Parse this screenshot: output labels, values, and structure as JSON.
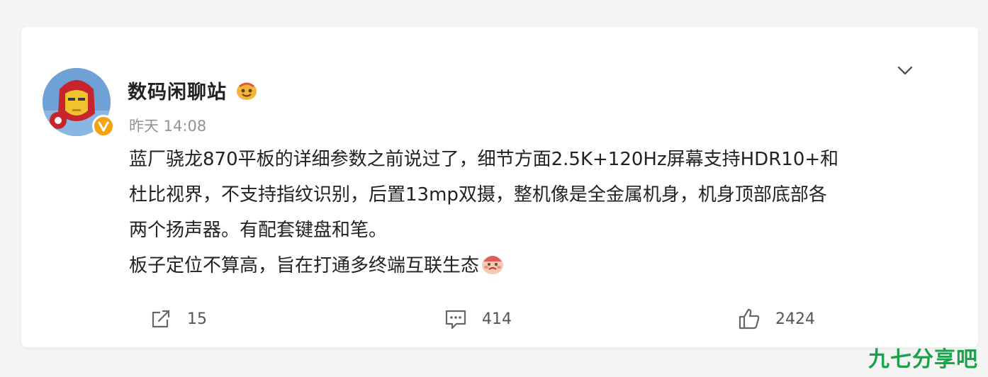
{
  "post": {
    "username": "数码闲聊站",
    "timestamp": "昨天 14:08",
    "content_lines": [
      "蓝厂骁龙870平板的详细参数之前说过了，细节方面2.5K+120Hz屏幕支持HDR10+和",
      "杜比视界，不支持指纹识别，后置13mp双摄，整机像是全金属机身，机身顶部底部各",
      "两个扬声器。有配套键盘和笔。",
      "板子定位不算高，旨在打通多终端互联生态"
    ]
  },
  "actions": {
    "repost_count": "15",
    "comment_count": "414",
    "like_count": "2424"
  },
  "icons": {
    "expand": "chevron-down-icon",
    "verified": "verified-v-icon",
    "badge": "super-fan-badge-icon",
    "emoji": "emoji-face-icon",
    "repost": "repost-icon",
    "comment": "comment-icon",
    "like": "thumbs-up-icon"
  },
  "colors": {
    "verified": "#f6a20d",
    "watermark": "#1aa34a",
    "muted": "#939393"
  },
  "watermark": "九七分享吧"
}
